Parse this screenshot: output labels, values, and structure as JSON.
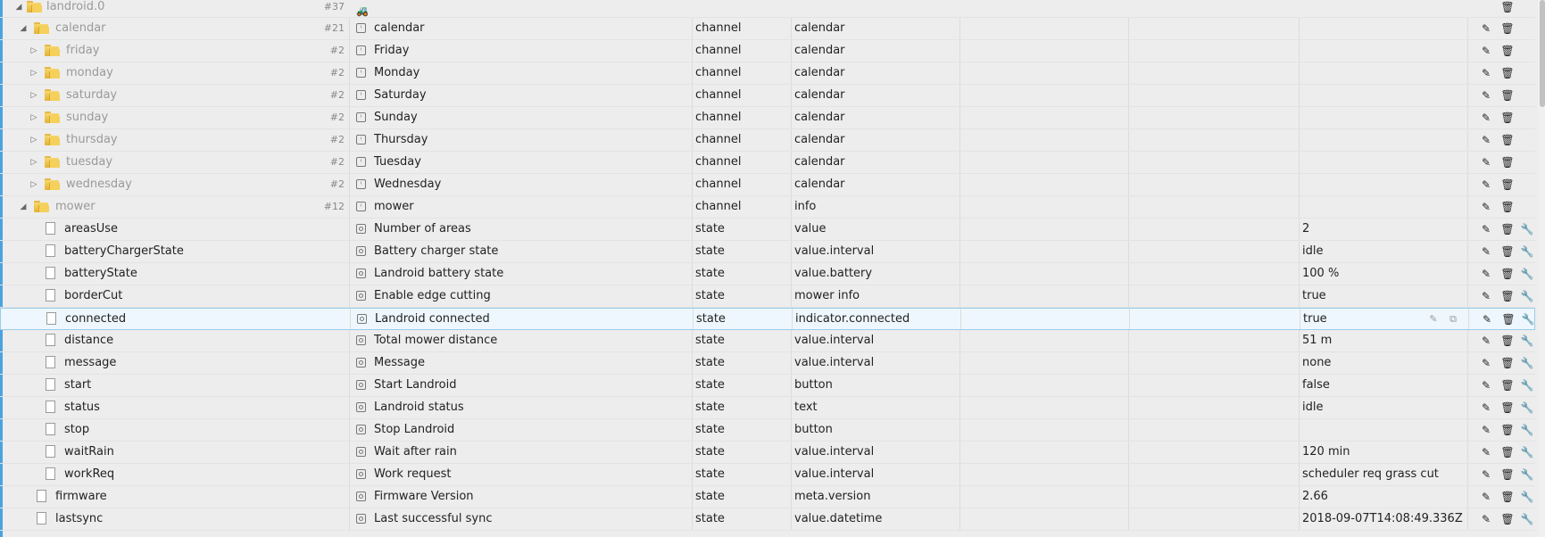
{
  "root": {
    "label": "landroid.0",
    "count": "#37"
  },
  "rows": [
    {
      "kind": "folder",
      "level": 1,
      "expanded": true,
      "id": "calendar",
      "count": "#21",
      "icon": "channel",
      "name": "calendar",
      "type": "channel",
      "role": "calendar",
      "value": "",
      "tools": false
    },
    {
      "kind": "folder",
      "level": 2,
      "expanded": false,
      "id": "friday",
      "count": "#2",
      "icon": "channel",
      "name": "Friday",
      "type": "channel",
      "role": "calendar",
      "value": "",
      "tools": false
    },
    {
      "kind": "folder",
      "level": 2,
      "expanded": false,
      "id": "monday",
      "count": "#2",
      "icon": "channel",
      "name": "Monday",
      "type": "channel",
      "role": "calendar",
      "value": "",
      "tools": false
    },
    {
      "kind": "folder",
      "level": 2,
      "expanded": false,
      "id": "saturday",
      "count": "#2",
      "icon": "channel",
      "name": "Saturday",
      "type": "channel",
      "role": "calendar",
      "value": "",
      "tools": false
    },
    {
      "kind": "folder",
      "level": 2,
      "expanded": false,
      "id": "sunday",
      "count": "#2",
      "icon": "channel",
      "name": "Sunday",
      "type": "channel",
      "role": "calendar",
      "value": "",
      "tools": false
    },
    {
      "kind": "folder",
      "level": 2,
      "expanded": false,
      "id": "thursday",
      "count": "#2",
      "icon": "channel",
      "name": "Thursday",
      "type": "channel",
      "role": "calendar",
      "value": "",
      "tools": false
    },
    {
      "kind": "folder",
      "level": 2,
      "expanded": false,
      "id": "tuesday",
      "count": "#2",
      "icon": "channel",
      "name": "Tuesday",
      "type": "channel",
      "role": "calendar",
      "value": "",
      "tools": false
    },
    {
      "kind": "folder",
      "level": 2,
      "expanded": false,
      "id": "wednesday",
      "count": "#2",
      "icon": "channel",
      "name": "Wednesday",
      "type": "channel",
      "role": "calendar",
      "value": "",
      "tools": false
    },
    {
      "kind": "folder",
      "level": 1,
      "expanded": true,
      "id": "mower",
      "count": "#12",
      "icon": "channel",
      "name": "mower",
      "type": "channel",
      "role": "info",
      "value": "",
      "tools": false
    },
    {
      "kind": "file",
      "level": 2,
      "id": "areasUse",
      "icon": "state",
      "name": "Number of areas",
      "type": "state",
      "role": "value",
      "value": "2",
      "tools": true
    },
    {
      "kind": "file",
      "level": 2,
      "id": "batteryChargerState",
      "icon": "state",
      "name": "Battery charger state",
      "type": "state",
      "role": "value.interval",
      "value": "idle",
      "tools": true
    },
    {
      "kind": "file",
      "level": 2,
      "id": "batteryState",
      "icon": "state",
      "name": "Landroid battery state",
      "type": "state",
      "role": "value.battery",
      "value": "100 %",
      "tools": true
    },
    {
      "kind": "file",
      "level": 2,
      "id": "borderCut",
      "icon": "state",
      "name": "Enable edge cutting",
      "type": "state",
      "role": "mower info",
      "value": "true",
      "tools": true
    },
    {
      "kind": "file",
      "level": 2,
      "id": "connected",
      "icon": "state",
      "name": "Landroid connected",
      "type": "state",
      "role": "indicator.connected",
      "value": "true",
      "tools": true,
      "selected": true
    },
    {
      "kind": "file",
      "level": 2,
      "id": "distance",
      "icon": "state",
      "name": "Total mower distance",
      "type": "state",
      "role": "value.interval",
      "value": "51 m",
      "tools": true
    },
    {
      "kind": "file",
      "level": 2,
      "id": "message",
      "icon": "state",
      "name": "Message",
      "type": "state",
      "role": "value.interval",
      "value": "none",
      "tools": true
    },
    {
      "kind": "file",
      "level": 2,
      "id": "start",
      "icon": "state",
      "name": "Start Landroid",
      "type": "state",
      "role": "button",
      "value": "false",
      "tools": true
    },
    {
      "kind": "file",
      "level": 2,
      "id": "status",
      "icon": "state",
      "name": "Landroid status",
      "type": "state",
      "role": "text",
      "value": "idle",
      "tools": true
    },
    {
      "kind": "file",
      "level": 2,
      "id": "stop",
      "icon": "state",
      "name": "Stop Landroid",
      "type": "state",
      "role": "button",
      "value": "",
      "tools": true
    },
    {
      "kind": "file",
      "level": 2,
      "id": "waitRain",
      "icon": "state",
      "name": "Wait after rain",
      "type": "state",
      "role": "value.interval",
      "value": "120 min",
      "tools": true
    },
    {
      "kind": "file",
      "level": 2,
      "id": "workReq",
      "icon": "state",
      "name": "Work request",
      "type": "state",
      "role": "value.interval",
      "value": "scheduler req grass cut",
      "tools": true
    },
    {
      "kind": "file",
      "level": 1,
      "id": "firmware",
      "icon": "state",
      "name": "Firmware Version",
      "type": "state",
      "role": "meta.version",
      "value": "2.66",
      "tools": true
    },
    {
      "kind": "file",
      "level": 1,
      "id": "lastsync",
      "icon": "state",
      "name": "Last successful sync",
      "type": "state",
      "role": "value.datetime",
      "value": "2018-09-07T14:08:49.336Z",
      "tools": true
    }
  ],
  "icons": {
    "edit": "✎",
    "delete": "🗑",
    "tools": "🔧",
    "copy": "⧉"
  },
  "colors": {
    "selection_border": "#9bcbeb",
    "selection_bg": "#eef7fd",
    "folder": "#f0c64f"
  }
}
